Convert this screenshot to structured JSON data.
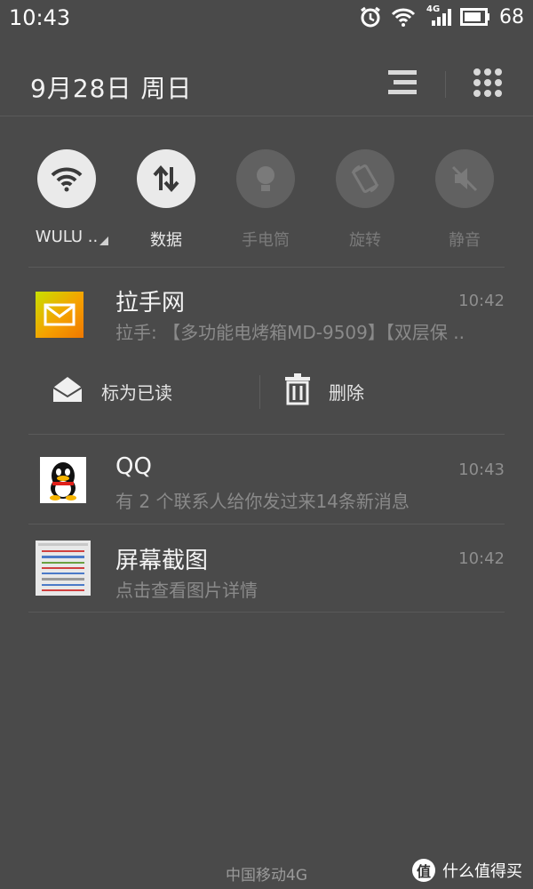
{
  "status_bar": {
    "time": "10:43",
    "network": "4G",
    "battery": "68",
    "icons": [
      "alarm-icon",
      "wifi-icon",
      "signal-icon",
      "battery-icon"
    ]
  },
  "header": {
    "date": "9月28日 周日",
    "buttons": [
      "list-icon",
      "grid-icon"
    ]
  },
  "toggles": [
    {
      "label": "WULU ..",
      "icon": "wifi-icon",
      "state": "on"
    },
    {
      "label": "数据",
      "icon": "data-arrows-icon",
      "state": "on"
    },
    {
      "label": "手电筒",
      "icon": "flashlight-icon",
      "state": "off"
    },
    {
      "label": "旋转",
      "icon": "rotate-icon",
      "state": "off"
    },
    {
      "label": "静音",
      "icon": "mute-icon",
      "state": "off"
    }
  ],
  "notifications": [
    {
      "app": "mail",
      "title": "拉手网",
      "time": "10:42",
      "text": "拉手: 【多功能电烤箱MD-9509】【双层保 ..",
      "actions": [
        {
          "label": "标为已读",
          "icon": "open-envelope-icon"
        },
        {
          "label": "删除",
          "icon": "trash-icon"
        }
      ]
    },
    {
      "app": "qq",
      "title": "QQ",
      "time": "10:43",
      "text": "有 2 个联系人给你发过来14条新消息"
    },
    {
      "app": "screenshot",
      "title": "屏幕截图",
      "time": "10:42",
      "text": "点击查看图片详情"
    }
  ],
  "footer": {
    "carrier": "中国移动4G",
    "watermark": "什么值得买",
    "watermark_logo": "值"
  },
  "colors": {
    "background": "#4a4a4a",
    "toggle_on": "#eaeaea",
    "toggle_off": "#616161",
    "mail_icon": "#f5a100"
  }
}
